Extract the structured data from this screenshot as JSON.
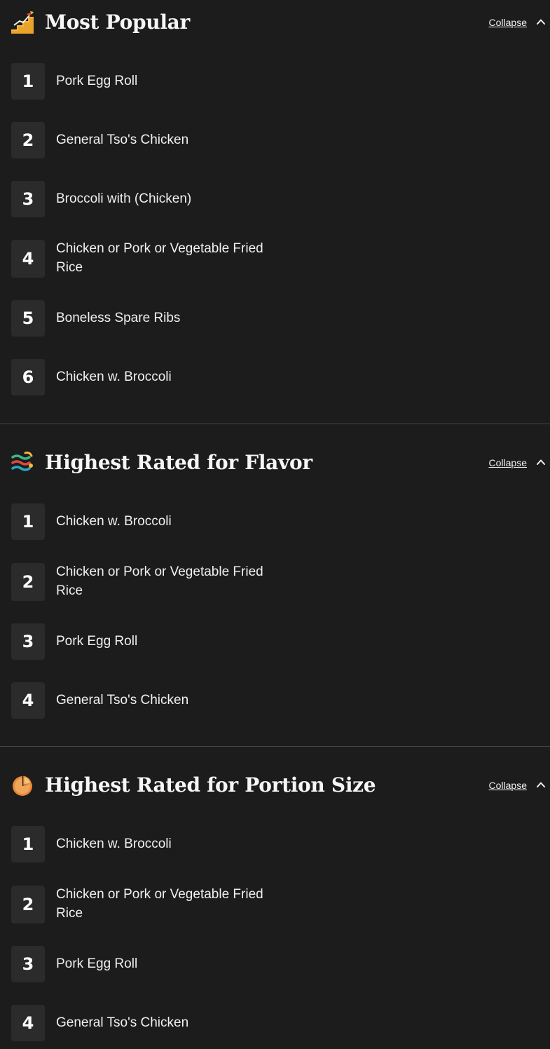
{
  "collapse_label": "Collapse",
  "sections": [
    {
      "title": "Most Popular",
      "icon": "stairs-trending-icon",
      "items": [
        {
          "rank": "1",
          "name": "Pork Egg Roll"
        },
        {
          "rank": "2",
          "name": "General Tso's Chicken"
        },
        {
          "rank": "3",
          "name": "Broccoli with (Chicken)"
        },
        {
          "rank": "4",
          "name": "Chicken or Pork or Vegetable Fried Rice"
        },
        {
          "rank": "5",
          "name": "Boneless Spare Ribs"
        },
        {
          "rank": "6",
          "name": "Chicken w. Broccoli"
        }
      ]
    },
    {
      "title": "Highest Rated for Flavor",
      "icon": "flavor-waves-icon",
      "items": [
        {
          "rank": "1",
          "name": "Chicken w. Broccoli"
        },
        {
          "rank": "2",
          "name": "Chicken or Pork or Vegetable Fried Rice"
        },
        {
          "rank": "3",
          "name": "Pork Egg Roll"
        },
        {
          "rank": "4",
          "name": "General Tso's Chicken"
        }
      ]
    },
    {
      "title": "Highest Rated for Portion Size",
      "icon": "pie-portion-icon",
      "items": [
        {
          "rank": "1",
          "name": "Chicken w. Broccoli"
        },
        {
          "rank": "2",
          "name": "Chicken or Pork or Vegetable Fried Rice"
        },
        {
          "rank": "3",
          "name": "Pork Egg Roll"
        },
        {
          "rank": "4",
          "name": "General Tso's Chicken"
        }
      ]
    }
  ]
}
